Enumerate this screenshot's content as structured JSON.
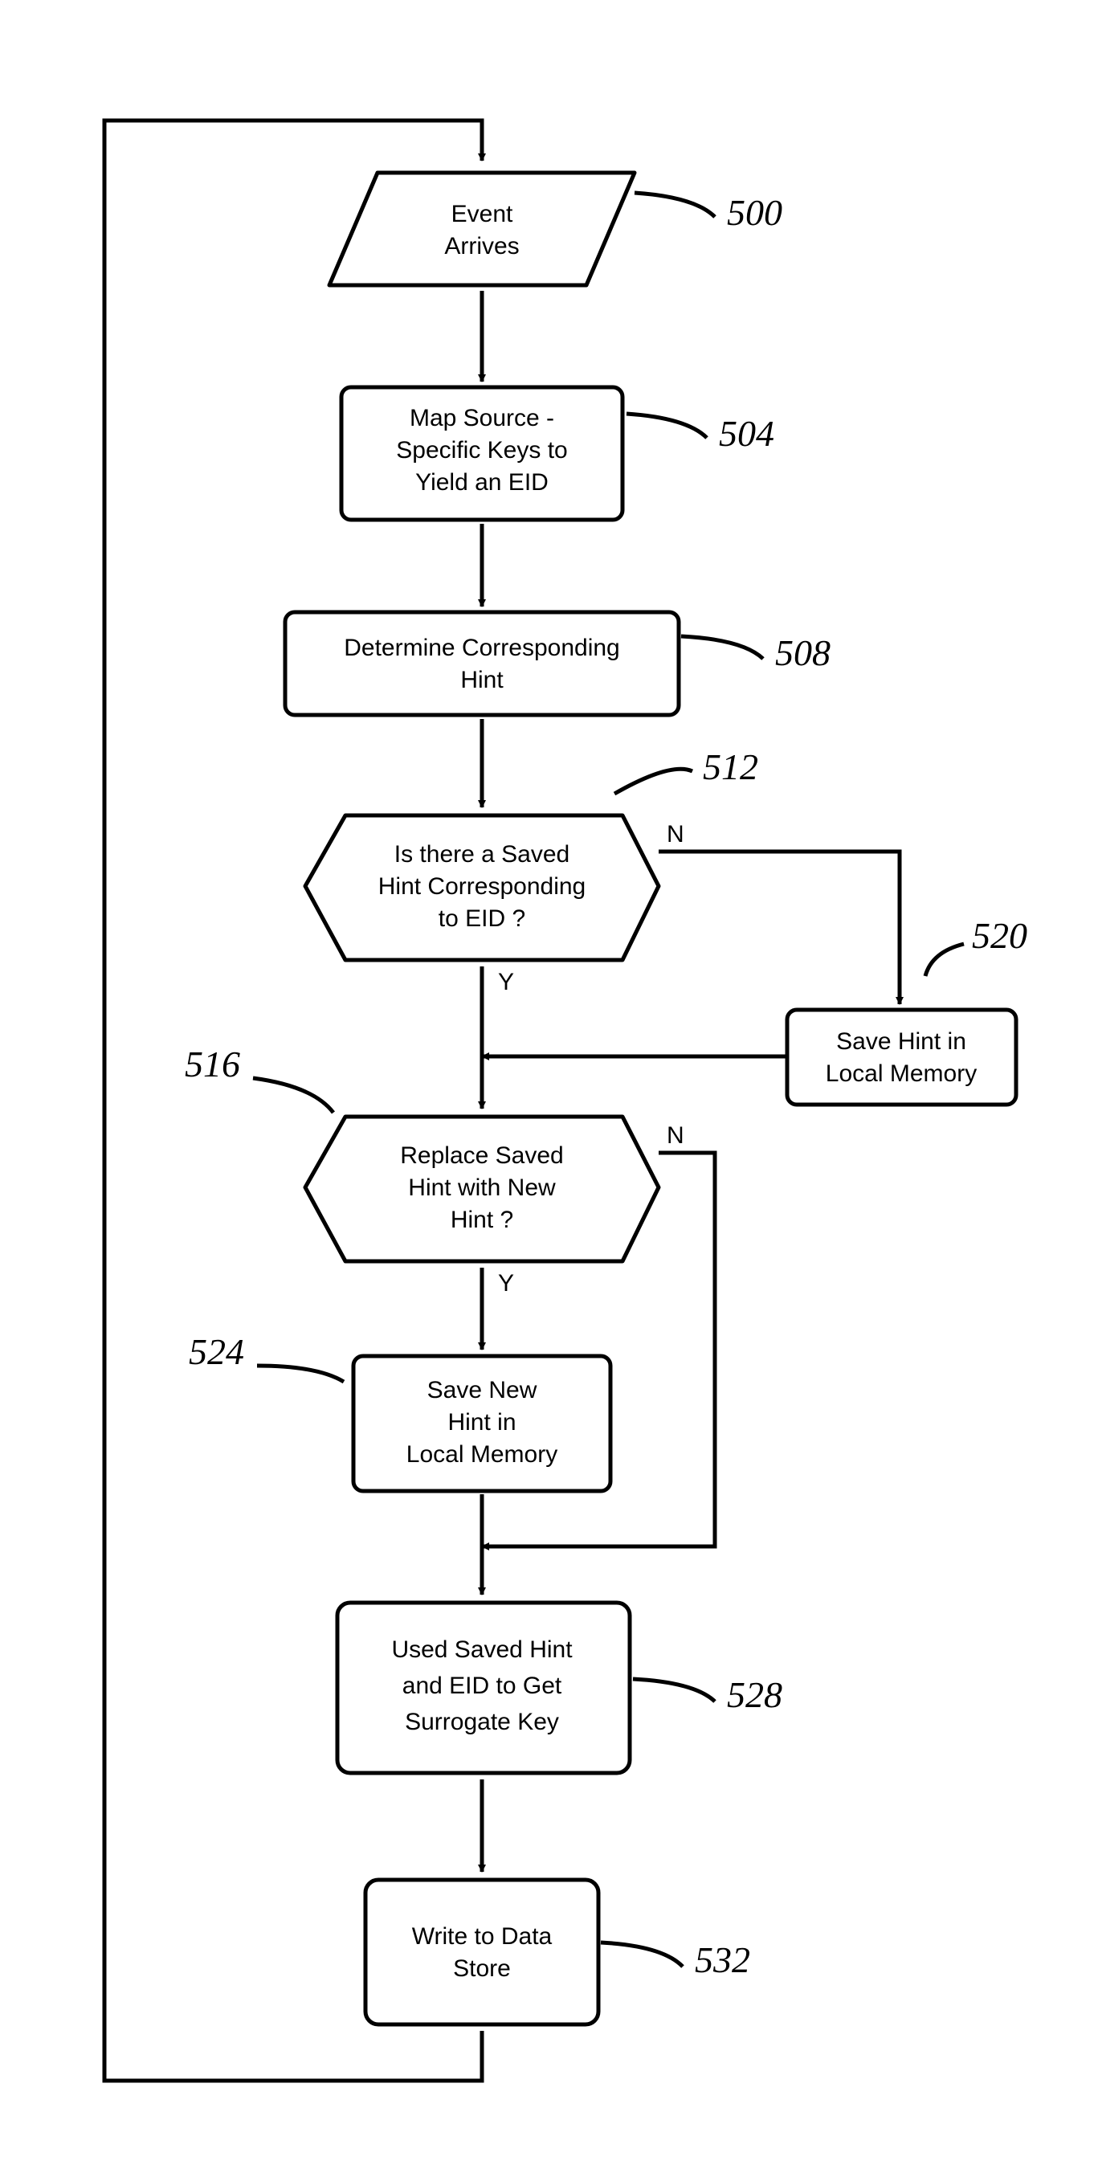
{
  "nodes": {
    "n500": {
      "label": "500",
      "lines": [
        "Event",
        "Arrives"
      ]
    },
    "n504": {
      "label": "504",
      "lines": [
        "Map Source -",
        "Specific Keys to",
        "Yield an EID"
      ]
    },
    "n508": {
      "label": "508",
      "lines": [
        "Determine Corresponding",
        "Hint"
      ]
    },
    "n512": {
      "label": "512",
      "lines": [
        "Is there a Saved",
        "Hint Corresponding",
        "to EID ?"
      ]
    },
    "n516": {
      "label": "516",
      "lines": [
        "Replace Saved",
        "Hint with New",
        "Hint ?"
      ]
    },
    "n520": {
      "label": "520",
      "lines": [
        "Save Hint in",
        "Local Memory"
      ]
    },
    "n524": {
      "label": "524",
      "lines": [
        "Save New",
        "Hint in",
        "Local Memory"
      ]
    },
    "n528": {
      "label": "528",
      "lines": [
        "Used Saved Hint",
        "and EID to Get",
        "Surrogate Key"
      ]
    },
    "n532": {
      "label": "532",
      "lines": [
        "Write to Data",
        "Store"
      ]
    }
  },
  "branches": {
    "yes": "Y",
    "no": "N"
  }
}
